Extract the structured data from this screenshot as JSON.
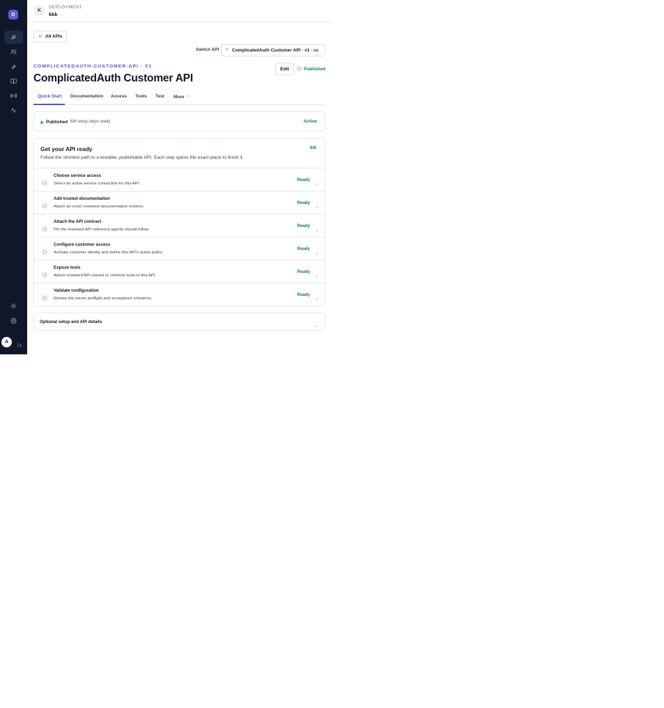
{
  "sidebar": {
    "brand_letter": "D",
    "nav": [
      {
        "icon": "deployments-icon",
        "active": true
      },
      {
        "icon": "users-icon",
        "active": false
      },
      {
        "icon": "wrench-icon",
        "active": false
      },
      {
        "icon": "book-icon",
        "active": false
      },
      {
        "icon": "broadcast-icon",
        "active": false
      },
      {
        "icon": "activity-icon",
        "active": false
      }
    ],
    "bottom": [
      {
        "icon": "theme-sun-icon"
      },
      {
        "icon": "settings-gear-icon"
      }
    ],
    "avatar_letter": "A",
    "logout_icon": "logout-icon"
  },
  "header": {
    "workspace_letter": "K",
    "workspace_kicker": "DEPLOYMENT",
    "workspace_name": "kkk"
  },
  "page": {
    "back_label": "All APIs",
    "switch_label": "Switch API",
    "switch_value": "ComplicatedAuth Customer API · v1 · cc",
    "slug": "COMPLICATEDAUTH-CUSTOMER-API · V1",
    "title": "ComplicatedAuth Customer API",
    "edit_label": "Edit",
    "publish_status": "Published"
  },
  "tabs": [
    {
      "label": "Quick Start",
      "active": true
    },
    {
      "label": "Documentation",
      "active": false
    },
    {
      "label": "Access",
      "active": false
    },
    {
      "label": "Tools",
      "active": false
    },
    {
      "label": "Test",
      "active": false
    },
    {
      "label": "More",
      "active": false
    }
  ],
  "status_card": {
    "title": "Published",
    "subtitle": "6/6 setup steps ready",
    "state": "Active"
  },
  "setup": {
    "title": "Get your API ready",
    "subtitle": "Follow the shortest path to a testable, publishable API. Each step opens the exact place to finish it.",
    "count": "6/6",
    "steps": [
      {
        "title": "Choose service access",
        "desc": "Select an active service connection for this API.",
        "status": "Ready"
      },
      {
        "title": "Add trusted documentation",
        "desc": "Attach an exact reviewed documentation revision.",
        "status": "Ready"
      },
      {
        "title": "Attach the API contract",
        "desc": "Pin the reviewed API reference agents should follow.",
        "status": "Ready"
      },
      {
        "title": "Configure customer access",
        "desc": "Activate customer identity and define this API's action policy.",
        "status": "Ready"
      },
      {
        "title": "Expose tools",
        "desc": "Attach reviewed API-owned or common tools to this API.",
        "status": "Ready"
      },
      {
        "title": "Validate configuration",
        "desc": "Review the server preflight and acceptance scenarios.",
        "status": "Ready"
      }
    ]
  },
  "optional": {
    "label": "Optional setup and API details"
  },
  "colors": {
    "sidebar_bg": "#0f1729",
    "accent": "#4f54c8",
    "success": "#15803d"
  }
}
